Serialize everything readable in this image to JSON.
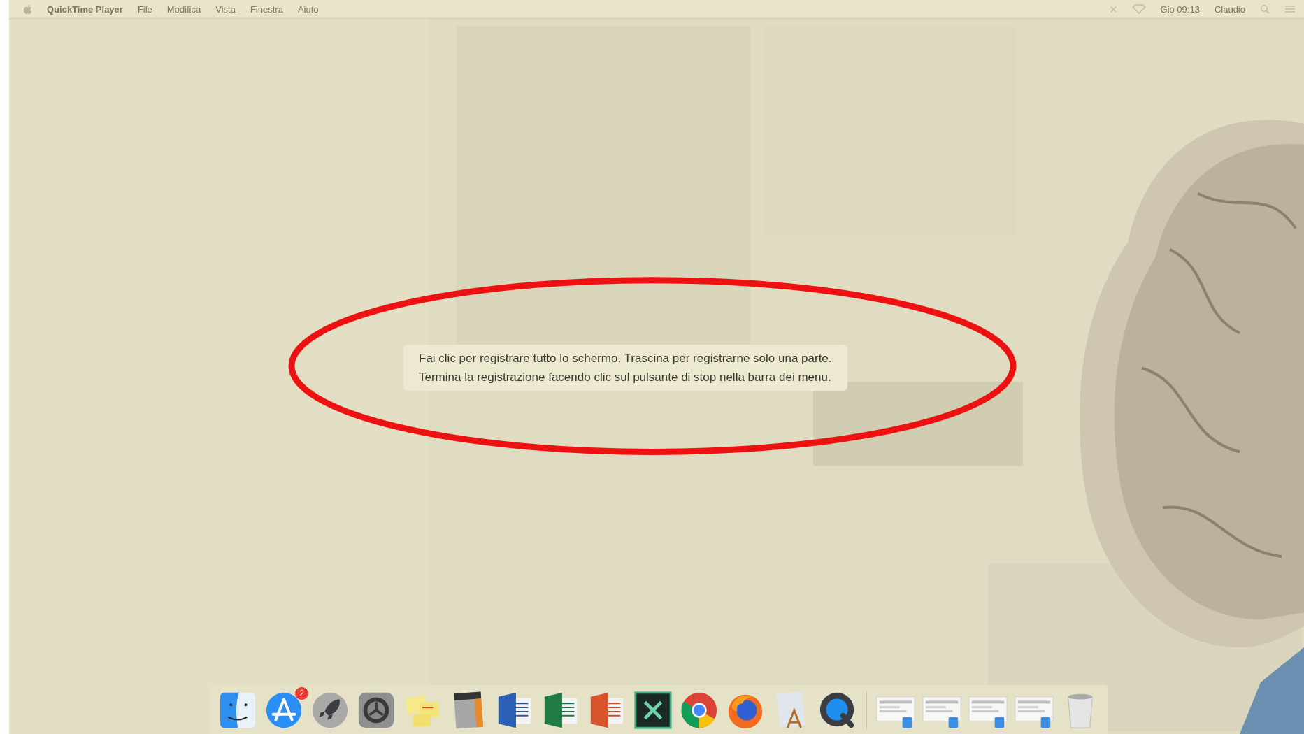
{
  "menu_bar": {
    "app_name": "QuickTime Player",
    "menus": [
      "File",
      "Modifica",
      "Vista",
      "Finestra",
      "Aiuto"
    ],
    "clock": "Gio 09:13",
    "user": "Claudio"
  },
  "hint": {
    "lines": [
      "Fai clic per registrare tutto lo schermo. Trascina per registrarne solo una parte.",
      "Termina la registrazione facendo clic sul pulsante di stop nella barra dei menu."
    ]
  },
  "annotation": {
    "kind": "ellipse",
    "color": "#ee1111"
  },
  "dock": {
    "items": [
      {
        "kind": "finder"
      },
      {
        "kind": "appstore",
        "badge": "2"
      },
      {
        "kind": "launchpad"
      },
      {
        "kind": "settings"
      },
      {
        "kind": "stickies"
      },
      {
        "kind": "calculator"
      },
      {
        "kind": "word"
      },
      {
        "kind": "excel"
      },
      {
        "kind": "powerpoint"
      },
      {
        "kind": "mindmap"
      },
      {
        "kind": "chrome"
      },
      {
        "kind": "firefox"
      },
      {
        "kind": "textedit"
      },
      {
        "kind": "quicktime"
      },
      {
        "kind": "separator"
      },
      {
        "kind": "thumbnail"
      },
      {
        "kind": "thumbnail"
      },
      {
        "kind": "thumbnail"
      },
      {
        "kind": "thumbnail"
      },
      {
        "kind": "trash"
      }
    ]
  }
}
